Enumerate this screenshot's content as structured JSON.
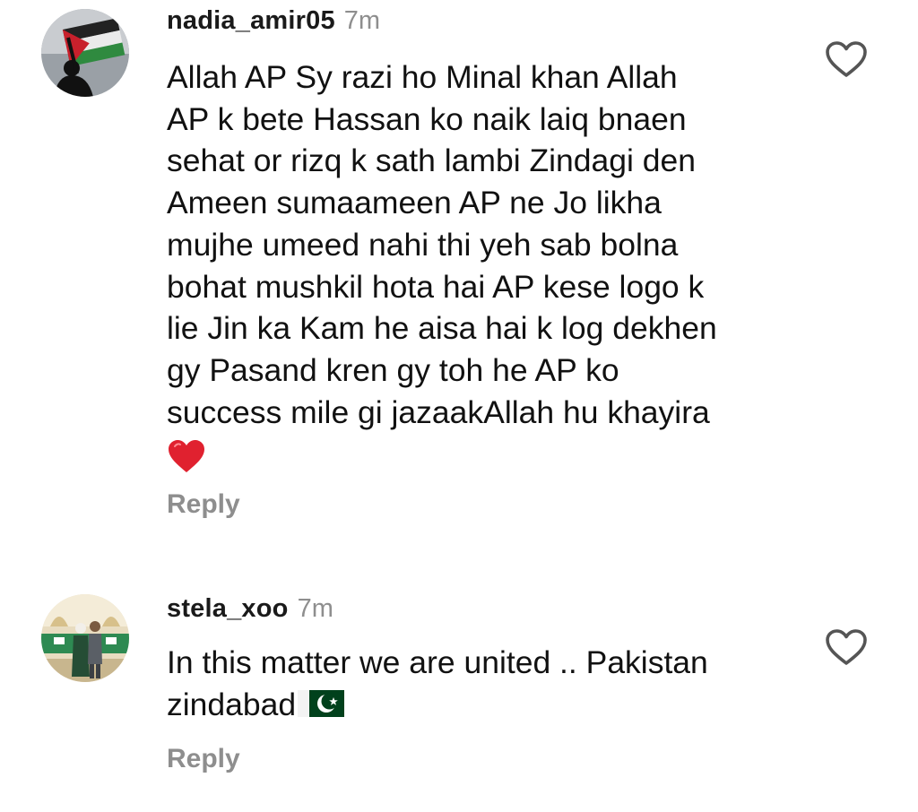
{
  "comments": [
    {
      "username": "nadia_amir05",
      "time": "7m",
      "text_lines": [
        "Allah AP Sy razi ho Minal khan Allah",
        "AP k bete Hassan ko naik laiq bnaen",
        "sehat or rizq k sath lambi Zindagi den",
        "Ameen sumaameen AP ne Jo likha",
        "mujhe umeed nahi thi yeh sab bolna",
        "bohat mushkil hota hai AP kese logo k",
        "lie Jin ka Kam he aisa hai k log dekhen",
        "gy Pasand kren gy toh he AP ko",
        "success mile gi jazaakAllah hu khayira"
      ],
      "emoji": "red-heart",
      "reply_label": "Reply",
      "avatar_icon": "palestine-flag-avatar"
    },
    {
      "username": "stela_xoo",
      "time": "7m",
      "text_lines": [
        "In this matter we are united .. Pakistan",
        "zindabad"
      ],
      "emoji": "pakistan-flag",
      "reply_label": "Reply",
      "avatar_icon": "couple-photo-avatar"
    }
  ],
  "colors": {
    "text": "#111111",
    "muted": "#8e8e8e",
    "heart": "#e0212f",
    "pk_green": "#01411c"
  }
}
